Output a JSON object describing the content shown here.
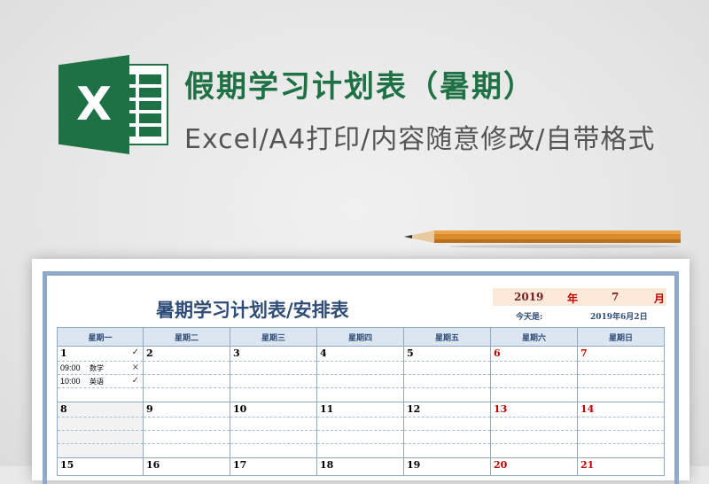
{
  "banner": {
    "title": "假期学习计划表（暑期）",
    "subtitle": "Excel/A4打印/内容随意修改/自带格式",
    "logo_letter": "X"
  },
  "colors": {
    "brand_green": "#1e7145",
    "header_blue": "#2f4d78",
    "weekend_red": "#c00000",
    "year_bg": "#fde9d9"
  },
  "sheet": {
    "title": "暑期学习计划表/安排表",
    "year": "2019",
    "year_label": "年",
    "month": "7",
    "month_label": "月",
    "today_label": "今天是:",
    "today_value": "2019年6月2日"
  },
  "weekdays": [
    "星期一",
    "星期二",
    "星期三",
    "星期四",
    "星期五",
    "星期六",
    "星期日"
  ],
  "weeks": [
    {
      "days": [
        {
          "num": "1",
          "mark": "✓",
          "tasks": [
            {
              "time": "09:00",
              "name": "数学",
              "mark": "×"
            },
            {
              "time": "10:00",
              "name": "英语",
              "mark": "✓"
            }
          ]
        },
        {
          "num": "2",
          "mark": "",
          "tasks": []
        },
        {
          "num": "3",
          "mark": "",
          "tasks": []
        },
        {
          "num": "4",
          "mark": "",
          "tasks": []
        },
        {
          "num": "5",
          "mark": "",
          "tasks": []
        },
        {
          "num": "6",
          "mark": "",
          "tasks": []
        },
        {
          "num": "7",
          "mark": "",
          "tasks": []
        }
      ]
    },
    {
      "days": [
        {
          "num": "8"
        },
        {
          "num": "9"
        },
        {
          "num": "10"
        },
        {
          "num": "11"
        },
        {
          "num": "12"
        },
        {
          "num": "13"
        },
        {
          "num": "14"
        }
      ]
    },
    {
      "days": [
        {
          "num": "15"
        },
        {
          "num": "16"
        },
        {
          "num": "17"
        },
        {
          "num": "18"
        },
        {
          "num": "19"
        },
        {
          "num": "20"
        },
        {
          "num": "21"
        }
      ]
    }
  ]
}
